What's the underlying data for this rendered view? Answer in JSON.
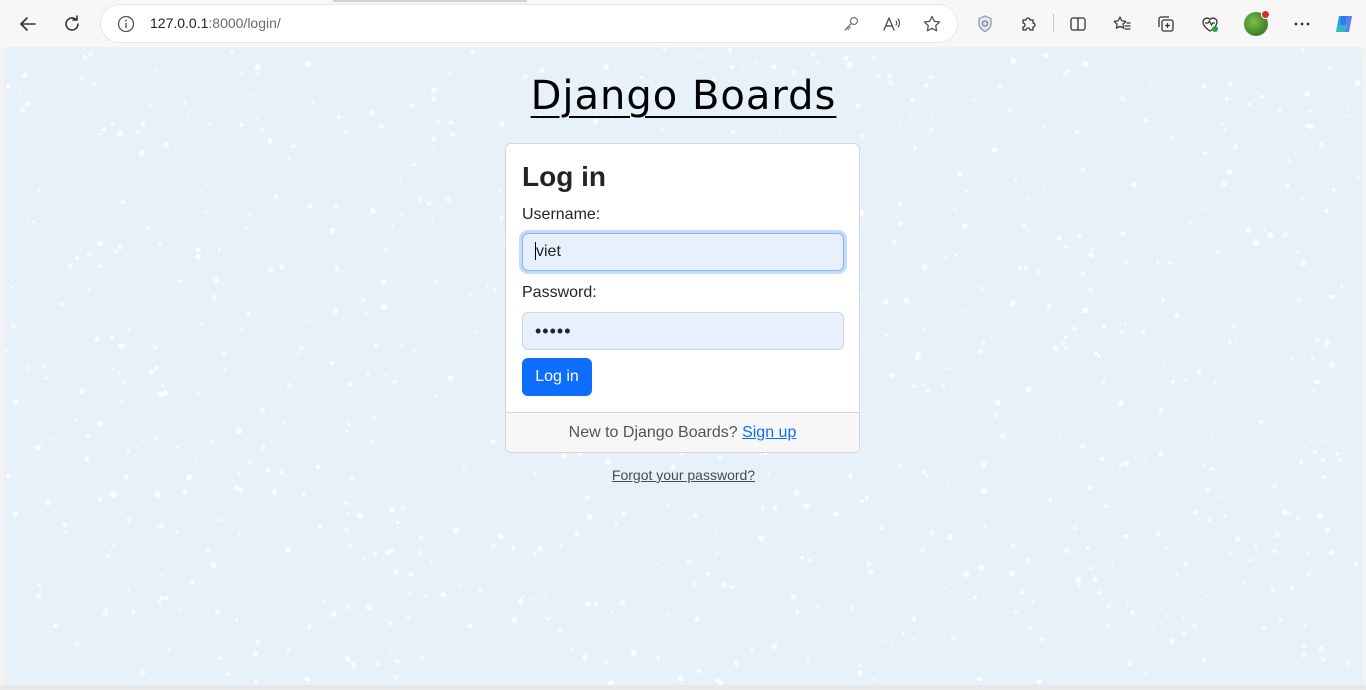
{
  "browser": {
    "url_host": "127.0.0.1",
    "url_path": ":8000/login/",
    "icons": {
      "back": "back-arrow-icon",
      "refresh": "refresh-icon",
      "info": "info-icon",
      "key": "key-icon",
      "read_aloud": "read-aloud-icon",
      "favorite": "star-icon",
      "shield": "shield-icon",
      "extensions": "puzzle-icon",
      "split": "split-screen-icon",
      "favorites": "favorites-icon",
      "collections": "collections-icon",
      "health": "browser-essentials-icon",
      "profile": "avatar",
      "more": "more-icon",
      "copilot": "copilot-icon"
    }
  },
  "page": {
    "site_title": "Django Boards",
    "card": {
      "title": "Log in",
      "username_label": "Username:",
      "username_value": "viet",
      "password_label": "Password:",
      "password_value": "•••••",
      "submit_label": "Log in"
    },
    "footer": {
      "text": "New to Django Boards?",
      "link": "Sign up"
    },
    "forgot_link": "Forgot your password?"
  },
  "colors": {
    "background": "#e6f1fa",
    "primary": "#0d6efd",
    "input_bg": "#e8f0fe"
  }
}
